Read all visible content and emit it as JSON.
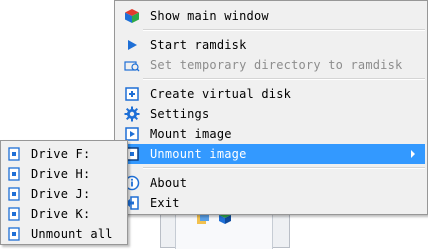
{
  "main_menu": {
    "items": [
      {
        "label": "Show main window",
        "icon": "cube-icon"
      },
      {
        "label": "Start ramdisk",
        "icon": "play-icon"
      },
      {
        "label": "Set temporary directory to ramdisk",
        "icon": "folder-search-icon",
        "disabled": true
      },
      {
        "label": "Create virtual disk",
        "icon": "plus-box-icon"
      },
      {
        "label": "Settings",
        "icon": "gear-icon"
      },
      {
        "label": "Mount image",
        "icon": "play-box-icon"
      },
      {
        "label": "Unmount image",
        "icon": "disk-icon",
        "highlighted": true,
        "submenu": true
      },
      {
        "label": "About",
        "icon": "info-icon"
      },
      {
        "label": "Exit",
        "icon": "exit-icon"
      }
    ]
  },
  "sub_menu": {
    "items": [
      {
        "label": "Drive F:",
        "icon": "drive-icon"
      },
      {
        "label": "Drive H:",
        "icon": "drive-icon"
      },
      {
        "label": "Drive J:",
        "icon": "drive-icon"
      },
      {
        "label": "Drive K:",
        "icon": "drive-icon"
      },
      {
        "label": "Unmount all",
        "icon": "drive-icon"
      }
    ]
  },
  "colors": {
    "highlight": "#3399ff",
    "menu_bg": "#f0f0f0",
    "icon_blue": "#1e6fd6"
  }
}
